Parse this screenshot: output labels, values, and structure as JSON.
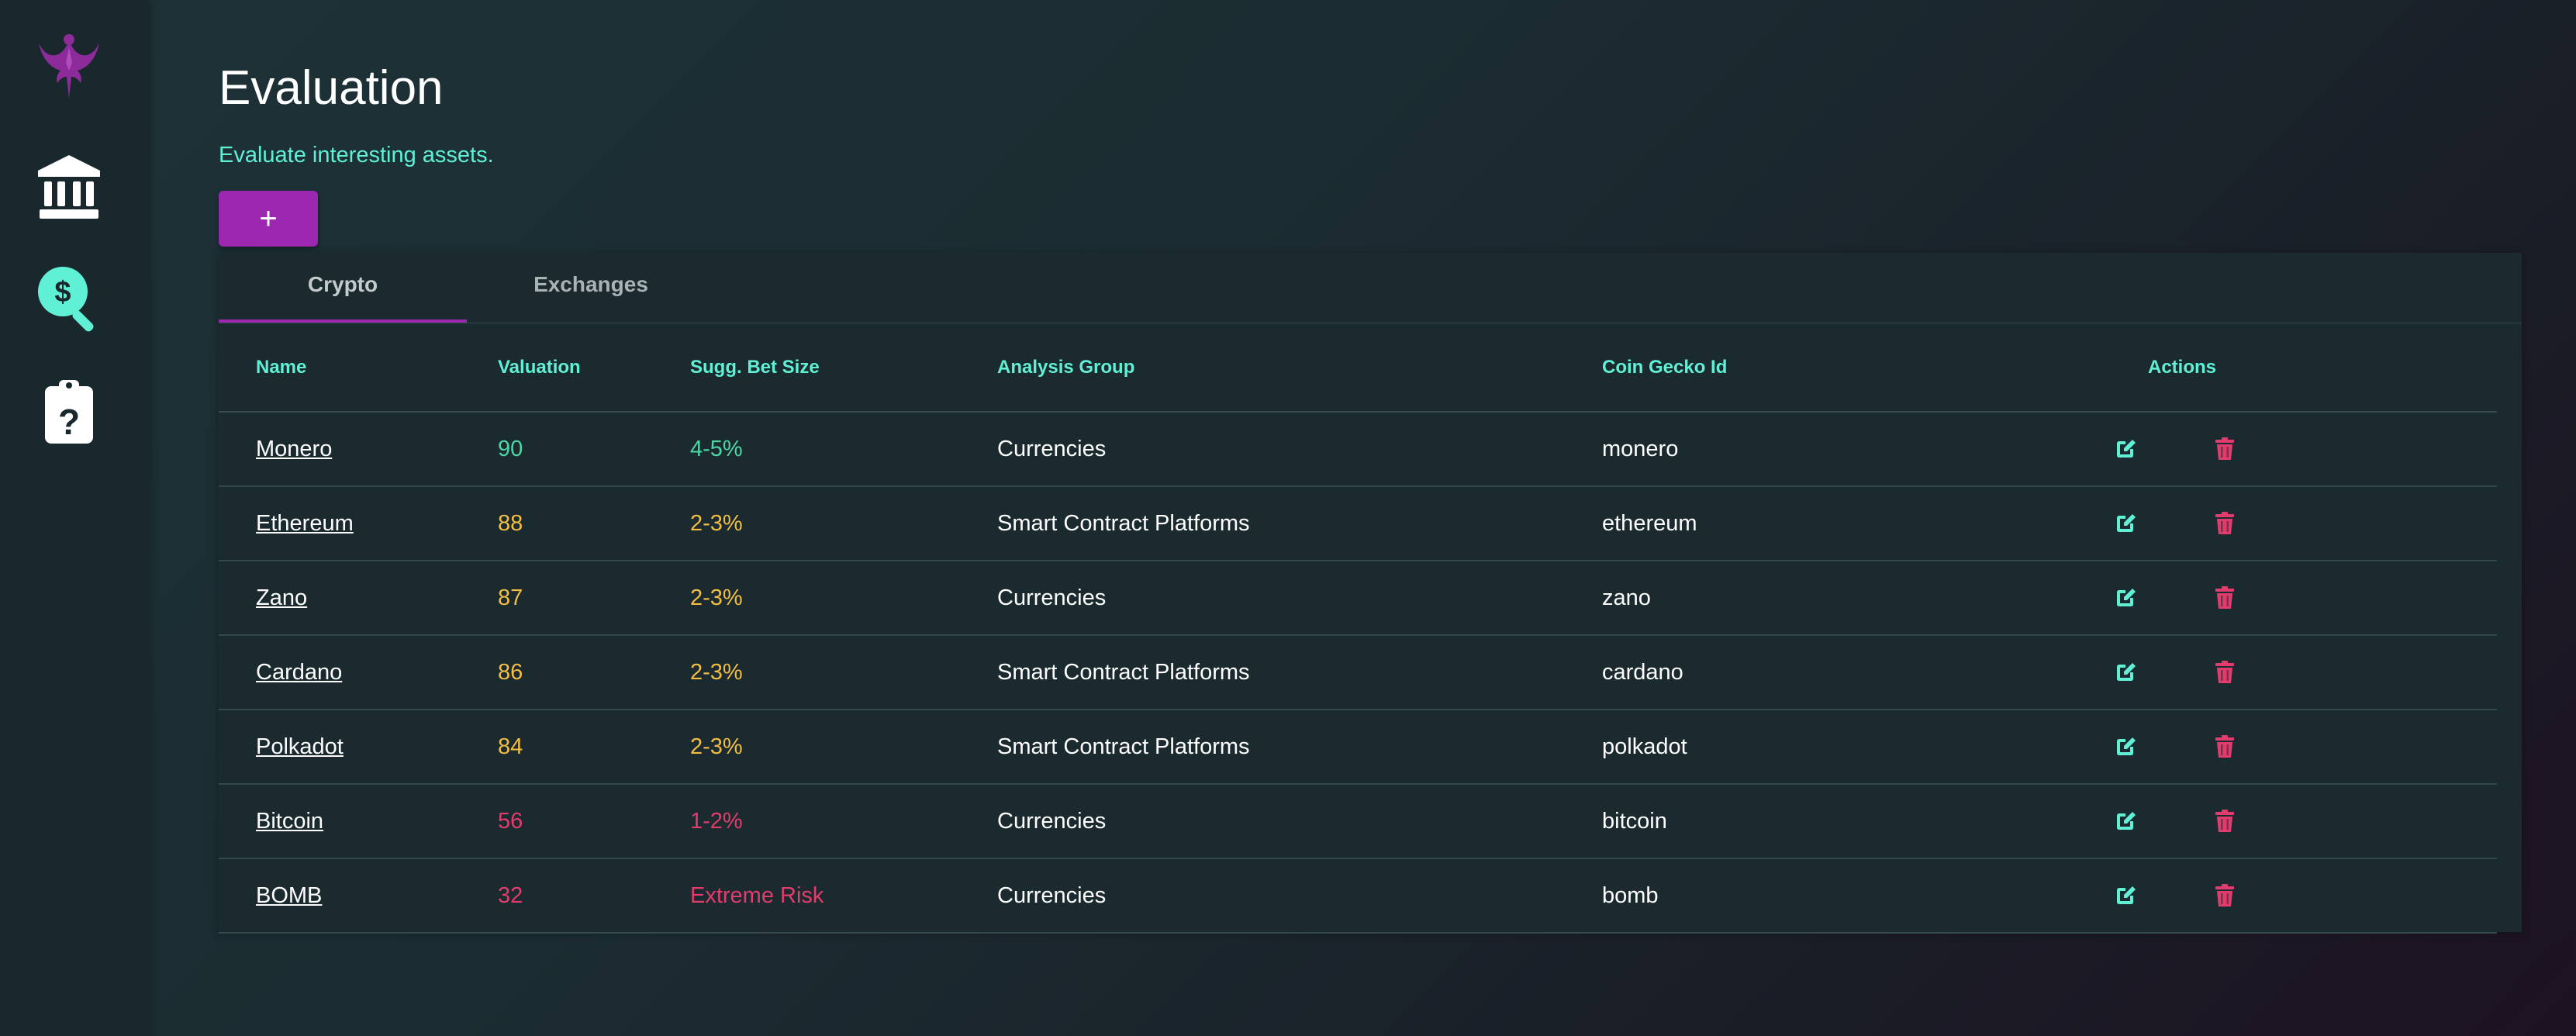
{
  "colors": {
    "accent": "#9c27b0",
    "teal": "#5ff0d6",
    "green": "#4cd7a5",
    "yellow": "#f2bd42",
    "red": "#e23c6d"
  },
  "sidebar": {
    "items": [
      {
        "icon": "phoenix-logo-icon"
      },
      {
        "icon": "bank-icon"
      },
      {
        "icon": "dollar-search-icon"
      },
      {
        "icon": "clipboard-question-icon"
      }
    ]
  },
  "page": {
    "title": "Evaluation",
    "subtitle": "Evaluate interesting assets.",
    "add_label": "+"
  },
  "tabs": [
    {
      "label": "Crypto",
      "active": true
    },
    {
      "label": "Exchanges",
      "active": false
    }
  ],
  "table": {
    "columns": [
      "Name",
      "Valuation",
      "Sugg. Bet Size",
      "Analysis Group",
      "Coin Gecko Id",
      "Actions"
    ],
    "rows": [
      {
        "name": "Monero",
        "valuation": "90",
        "bet": "4-5%",
        "group": "Currencies",
        "gecko": "monero",
        "tone": "green"
      },
      {
        "name": "Ethereum",
        "valuation": "88",
        "bet": "2-3%",
        "group": "Smart Contract Platforms",
        "gecko": "ethereum",
        "tone": "yellow"
      },
      {
        "name": "Zano",
        "valuation": "87",
        "bet": "2-3%",
        "group": "Currencies",
        "gecko": "zano",
        "tone": "yellow"
      },
      {
        "name": "Cardano",
        "valuation": "86",
        "bet": "2-3%",
        "group": "Smart Contract Platforms",
        "gecko": "cardano",
        "tone": "yellow"
      },
      {
        "name": "Polkadot",
        "valuation": "84",
        "bet": "2-3%",
        "group": "Smart Contract Platforms",
        "gecko": "polkadot",
        "tone": "yellow"
      },
      {
        "name": "Bitcoin",
        "valuation": "56",
        "bet": "1-2%",
        "group": "Currencies",
        "gecko": "bitcoin",
        "tone": "red"
      },
      {
        "name": "BOMB",
        "valuation": "32",
        "bet": "Extreme Risk",
        "group": "Currencies",
        "gecko": "bomb",
        "tone": "red"
      }
    ]
  }
}
